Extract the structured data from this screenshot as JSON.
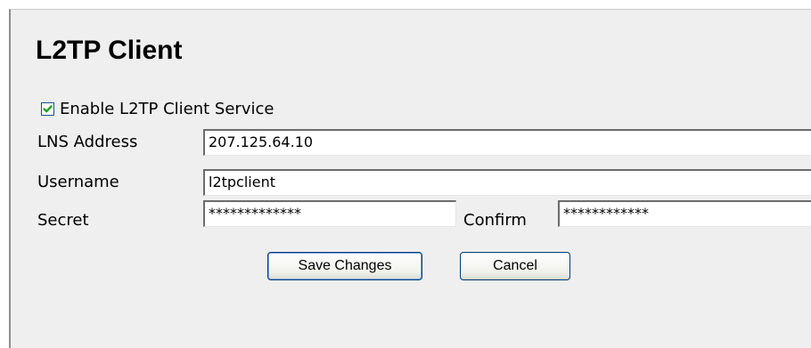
{
  "page": {
    "title": "L2TP Client"
  },
  "enable": {
    "label": "Enable L2TP Client Service",
    "checked": true
  },
  "fields": {
    "lns_address": {
      "label": "LNS Address",
      "value": "207.125.64.10"
    },
    "username": {
      "label": "Username",
      "value": "l2tpclient"
    },
    "secret": {
      "label": "Secret",
      "value": "*************"
    },
    "confirm": {
      "label": "Confirm",
      "value": "************"
    }
  },
  "buttons": {
    "save_label": "Save Changes",
    "cancel_label": "Cancel"
  },
  "colors": {
    "panel_bg": "#efefef",
    "checkmark": "#21a121",
    "button_border": "#003c74"
  }
}
